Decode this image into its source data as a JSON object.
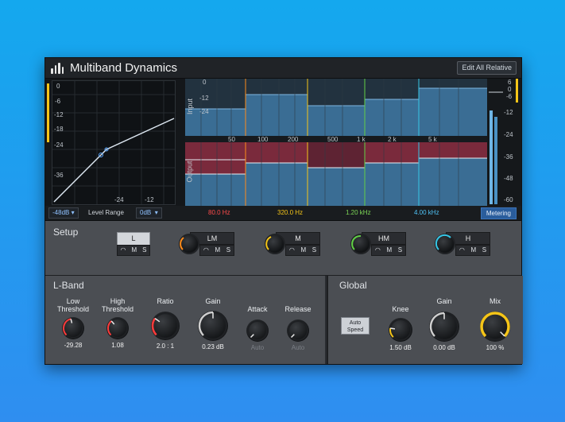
{
  "header": {
    "title": "Multiband Dynamics",
    "edit_all_label": "Edit All Relative"
  },
  "curve": {
    "y_ticks": [
      "0",
      "-6",
      "-12",
      "-18",
      "-24",
      "-36"
    ],
    "x_ticks": [
      "-24",
      "-12"
    ]
  },
  "spectrum": {
    "input_label": "Input",
    "output_label": "Output",
    "db_ticks": [
      "0",
      "-12",
      "-24"
    ],
    "freq_ticks": [
      "50",
      "100",
      "200",
      "500",
      "1 k",
      "2 k",
      "5 k"
    ]
  },
  "meter": {
    "ticks": [
      "6",
      "0",
      "-6",
      "-12",
      "-24",
      "-36",
      "-48",
      "-60"
    ]
  },
  "readouts": {
    "range_low": "-48dB",
    "level_range_label": "Level Range",
    "range_high": "0dB",
    "freqs": [
      {
        "value": "80.0 Hz",
        "color": "#ff4b4b"
      },
      {
        "value": "320.0 Hz",
        "color": "#f5c518"
      },
      {
        "value": "1.20 kHz",
        "color": "#7ed957"
      },
      {
        "value": "4.00 kHz",
        "color": "#4fc3f7"
      }
    ],
    "metering_label": "Metering"
  },
  "setup": {
    "title": "Setup",
    "bands": [
      {
        "label": "L",
        "color": "#d0d4d9"
      },
      {
        "label": "LM",
        "color": "#ff8c1a"
      },
      {
        "label": "M",
        "color": "#f5c518"
      },
      {
        "label": "HM",
        "color": "#62d046"
      },
      {
        "label": "H",
        "color": "#36c6e6"
      }
    ],
    "sub_labels": [
      "◠",
      "M",
      "S"
    ]
  },
  "lband": {
    "title": "L-Band",
    "params": [
      {
        "label": "Low\nThreshold",
        "value": "-29.28",
        "color": "#ff3b3b",
        "level": 0.45
      },
      {
        "label": "High\nThreshold",
        "value": "1.08",
        "color": "#ff3b3b",
        "level": 0.35
      },
      {
        "label": "Ratio",
        "value": "2.0 : 1",
        "color": "#ff3b3b",
        "level": 0.3
      },
      {
        "label": "Gain",
        "value": "0.23 dB",
        "color": "#cfcfcf",
        "level": 0.5
      },
      {
        "label": "Attack",
        "value": "Auto",
        "color": "#555",
        "level": 0.0
      },
      {
        "label": "Release",
        "value": "Auto",
        "color": "#555",
        "level": 0.0
      }
    ]
  },
  "global": {
    "title": "Global",
    "auto_speed_label": "Auto\nSpeed",
    "params": [
      {
        "label": "Knee",
        "value": "1.50 dB",
        "color": "#f5c518",
        "level": 0.2
      },
      {
        "label": "Gain",
        "value": "0.00 dB",
        "color": "#cfcfcf",
        "level": 0.5
      },
      {
        "label": "Mix",
        "value": "100 %",
        "color": "#f5c518",
        "level": 1.0
      }
    ]
  }
}
